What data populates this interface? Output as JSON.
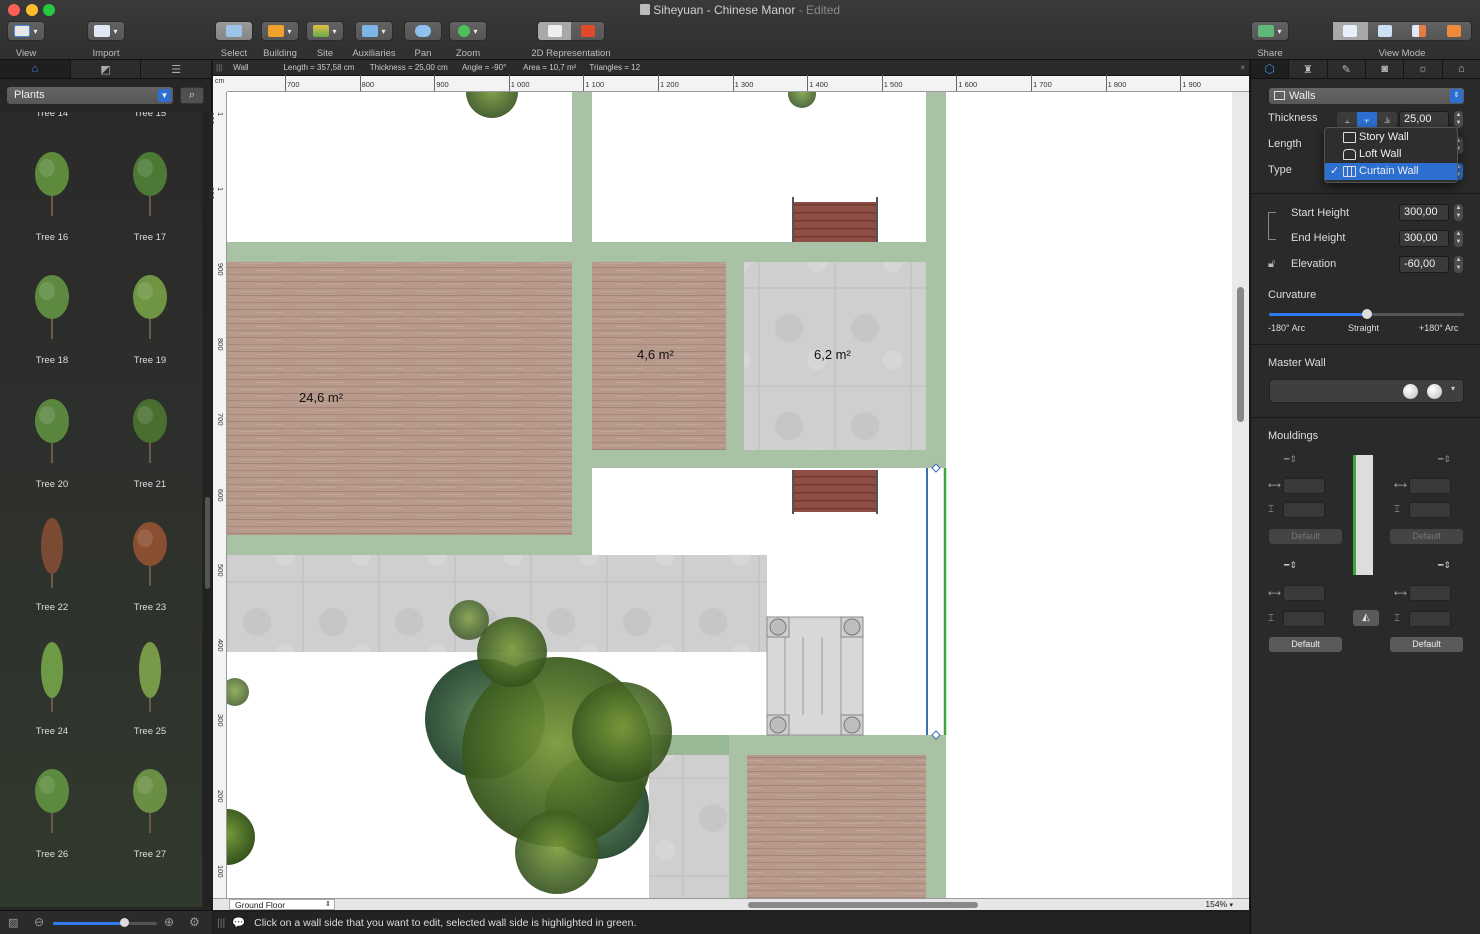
{
  "window": {
    "title": "Siheyuan - Chinese Manor",
    "edited": "Edited"
  },
  "toolbar": {
    "view": "View",
    "import": "Import",
    "select": "Select",
    "building": "Building",
    "site": "Site",
    "auxiliaries": "Auxiliaries",
    "pan": "Pan",
    "zoom": "Zoom",
    "representation": "2D Representation",
    "share": "Share",
    "view_mode": "View Mode"
  },
  "library": {
    "category": "Plants",
    "items": [
      "Tree 14",
      "Tree 15",
      "Tree 16",
      "Tree 17",
      "Tree 18",
      "Tree 19",
      "Tree 20",
      "Tree 21",
      "Tree 22",
      "Tree 23",
      "Tree 24",
      "Tree 25",
      "Tree 26",
      "Tree 27"
    ]
  },
  "infobar": {
    "object": "Wall",
    "length": "Length = 357,58 cm",
    "thickness": "Thickness = 25,00 cm",
    "angle": "Angle = -90°",
    "area": "Area = 10,7 m²",
    "triangles": "Triangles = 12"
  },
  "ruler": {
    "unit": "cm",
    "top": [
      "700",
      "800",
      "900",
      "1 000",
      "1 100",
      "1 200",
      "1 300",
      "1 400",
      "1 500",
      "1 600",
      "1 700",
      "1 800",
      "1 900"
    ],
    "left": [
      "1 100",
      "1 000",
      "900",
      "800",
      "700",
      "600",
      "500",
      "400",
      "300",
      "200",
      "100"
    ]
  },
  "plan": {
    "room_areas": [
      "24,6 m²",
      "4,6 m²",
      "6,2 m²"
    ],
    "floor": "Ground Floor",
    "zoom": "154%"
  },
  "status": "Click on a wall side that you want to edit, selected wall side is highlighted in green.",
  "inspector": {
    "object_type": "Walls",
    "thickness_label": "Thickness",
    "thickness_value": "25,00",
    "length_label": "Length",
    "type_label": "Type",
    "type_options": [
      "Story Wall",
      "Loft Wall",
      "Curtain Wall"
    ],
    "type_selected": "Curtain Wall",
    "start_height_label": "Start Height",
    "start_height": "300,00",
    "end_height_label": "End Height",
    "end_height": "300,00",
    "elevation_label": "Elevation",
    "elevation": "-60,00",
    "curvature_label": "Curvature",
    "curvature_left": "-180° Arc",
    "curvature_mid": "Straight",
    "curvature_right": "+180° Arc",
    "curvature_level": 0.5,
    "master_wall_label": "Master Wall",
    "mouldings_label": "Mouldings",
    "default_label": "Default"
  },
  "colors": {
    "accent": "#2d6fd1",
    "wall": "#a9c2a6",
    "selected_wall": "#3aa83a"
  }
}
